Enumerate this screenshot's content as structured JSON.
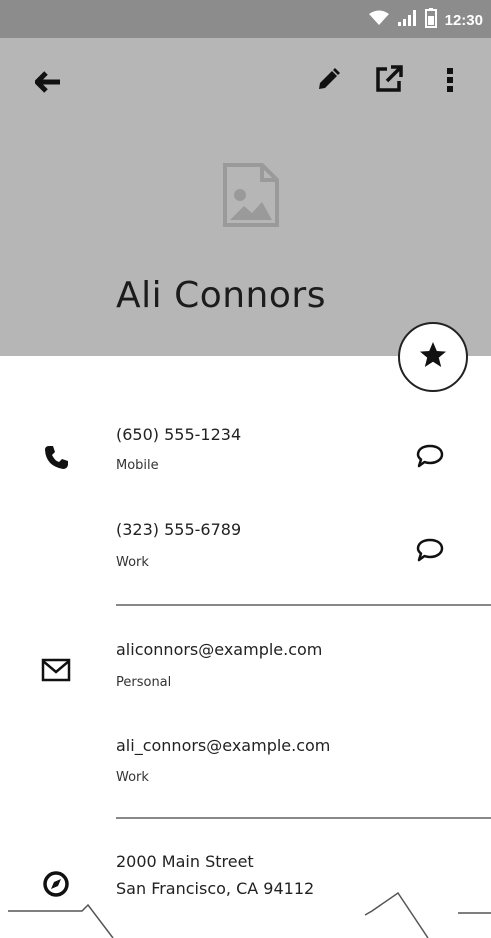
{
  "status_bar": {
    "time": "12:30",
    "icons": [
      "wifi-icon",
      "signal-icon",
      "battery-icon"
    ]
  },
  "toolbar": {
    "icons": [
      "back-arrow-icon",
      "edit-pencil-icon",
      "open-external-icon",
      "more-vert-icon"
    ]
  },
  "header": {
    "image_icon": "image-placeholder-icon",
    "name": "Ali Connors",
    "fab_icon": "star-icon"
  },
  "phones": {
    "section_icon": "phone-icon",
    "items": [
      {
        "number": "(650) 555-1234",
        "type": "Mobile",
        "action_icon": "message-bubble-icon"
      },
      {
        "number": "(323) 555-6789",
        "type": "Work",
        "action_icon": "message-bubble-icon"
      }
    ]
  },
  "emails": {
    "section_icon": "mail-icon",
    "items": [
      {
        "address": "aliconnors@example.com",
        "type": "Personal"
      },
      {
        "address": "ali_connors@example.com",
        "type": "Work"
      }
    ]
  },
  "address": {
    "section_icon": "compass-icon",
    "line1": "2000 Main Street",
    "line2": "San Francisco, CA 94112"
  },
  "colors": {
    "status_bar": "#8c8c8c",
    "header": "#b6b6b6",
    "text": "#222222"
  }
}
